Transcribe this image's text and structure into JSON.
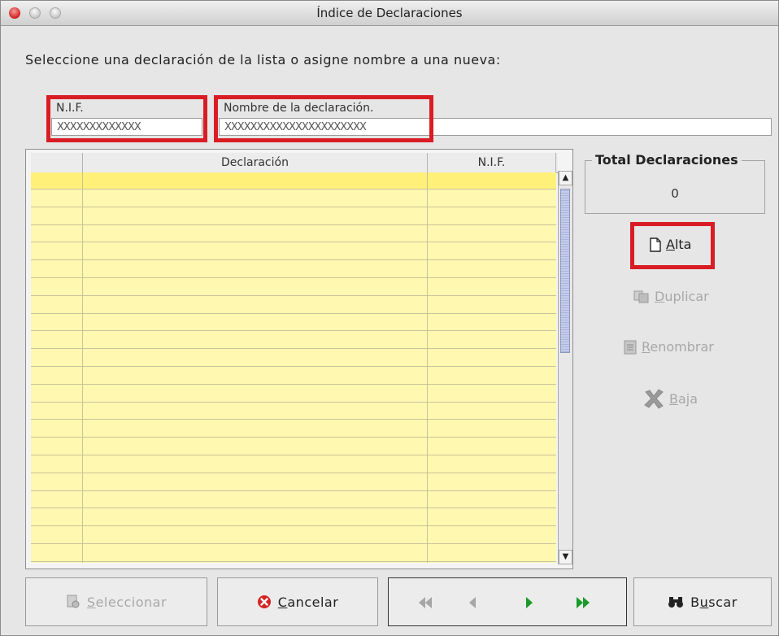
{
  "window": {
    "title": "Índice de Declaraciones"
  },
  "prompt": "Seleccione una declaración de la lista o asigne nombre a una nueva:",
  "nif_field": {
    "label": "N.I.F.",
    "value": "XXXXXXXXXXXXX"
  },
  "name_field": {
    "label": "Nombre de la declaración.",
    "value": "XXXXXXXXXXXXXXXXXXXXXX"
  },
  "table": {
    "columns": [
      "",
      "Declaración",
      "N.I.F."
    ],
    "row_count": 22
  },
  "total": {
    "title": "Total Declaraciones",
    "value": "0"
  },
  "side_buttons": {
    "alta": {
      "prefix": "",
      "accel": "A",
      "rest": "lta",
      "icon": "new-document-icon"
    },
    "duplicar": {
      "accel": "D",
      "rest": "uplicar",
      "icon": "duplicate-icon"
    },
    "renombrar": {
      "accel": "R",
      "rest": "enombrar",
      "icon": "rename-icon"
    },
    "baja": {
      "accel": "B",
      "rest": "aja",
      "icon": "delete-x-icon"
    }
  },
  "bottom": {
    "seleccionar": {
      "accel": "S",
      "rest": "eleccionar",
      "icon": "select-icon"
    },
    "cancelar": {
      "accel": "C",
      "rest": "ancelar",
      "icon": "cancel-icon"
    },
    "buscar": {
      "pre": "B",
      "accel": "u",
      "rest": "scar",
      "icon": "binoculars-icon"
    },
    "nav_icons": [
      "first-icon",
      "previous-icon",
      "next-icon",
      "last-icon"
    ]
  },
  "colors": {
    "highlight": "#d91d25",
    "row": "#fff8b0",
    "row_selected": "#fff07a",
    "nav_green": "#1a9a2a"
  }
}
